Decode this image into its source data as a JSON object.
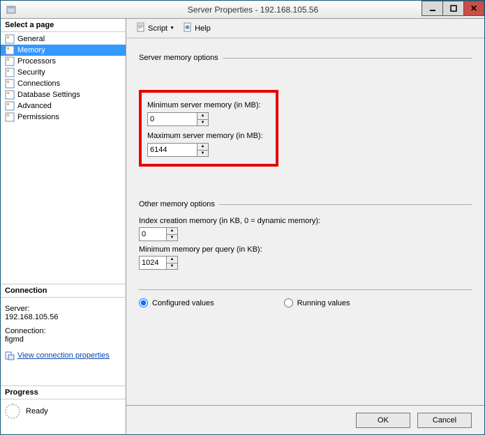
{
  "window": {
    "title": "Server Properties - 192.168.105.56"
  },
  "left": {
    "select_page_label": "Select a page",
    "pages": [
      {
        "label": "General"
      },
      {
        "label": "Memory"
      },
      {
        "label": "Processors"
      },
      {
        "label": "Security"
      },
      {
        "label": "Connections"
      },
      {
        "label": "Database Settings"
      },
      {
        "label": "Advanced"
      },
      {
        "label": "Permissions"
      }
    ],
    "connection_label": "Connection",
    "server_lbl": "Server:",
    "server_val": "192.168.105.56",
    "conn_lbl": "Connection:",
    "conn_val": "figmd",
    "view_link": "View connection properties",
    "progress_label": "Progress",
    "progress_status": "Ready"
  },
  "toolbar": {
    "script_label": "Script",
    "help_label": "Help"
  },
  "memory": {
    "group1": "Server memory options",
    "min_label": "Minimum server memory (in MB):",
    "min_value": "0",
    "max_label": "Maximum server memory (in MB):",
    "max_value": "6144",
    "group2": "Other memory options",
    "index_label": "Index creation memory (in KB, 0 = dynamic memory):",
    "index_value": "0",
    "minq_label": "Minimum memory per query (in KB):",
    "minq_value": "1024",
    "configured_label": "Configured values",
    "running_label": "Running values"
  },
  "footer": {
    "ok": "OK",
    "cancel": "Cancel"
  }
}
